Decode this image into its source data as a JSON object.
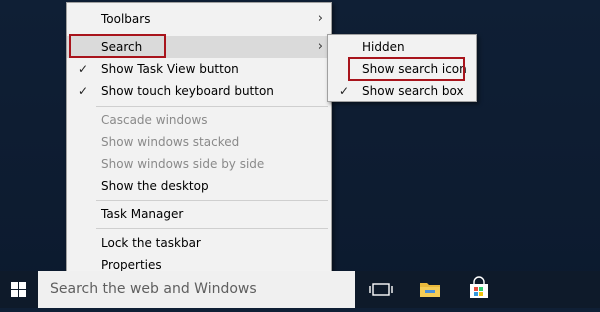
{
  "context_menu": {
    "items": [
      {
        "label": "Toolbars",
        "submenu_arrow": "chevron-right-icon"
      },
      {
        "label": "Search",
        "submenu_arrow": "chevron-right-icon",
        "state": "highlighted"
      },
      {
        "label": "Show Task View button",
        "checked": true
      },
      {
        "label": "Show touch keyboard button",
        "checked": true
      },
      {
        "label": "Cascade windows",
        "disabled": true
      },
      {
        "label": "Show windows stacked",
        "disabled": true
      },
      {
        "label": "Show windows side by side",
        "disabled": true
      },
      {
        "label": "Show the desktop"
      },
      {
        "label": "Task Manager"
      },
      {
        "label": "Lock the taskbar"
      },
      {
        "label": "Properties"
      }
    ],
    "check_glyph": "✓",
    "chevron_glyph": "›"
  },
  "search_submenu": {
    "items": [
      {
        "label": "Hidden"
      },
      {
        "label": "Show search icon",
        "annotated": true
      },
      {
        "label": "Show search box",
        "checked": true
      }
    ]
  },
  "taskbar": {
    "start_icon": "windows-logo-icon",
    "search_placeholder": "Search the web and Windows",
    "task_view_icon": "task-view-icon",
    "file_explorer_icon": "folder-icon",
    "store_icon": "store-bag-icon"
  },
  "colors": {
    "annotation_red": "#a8141c",
    "menu_bg": "#f2f2f2",
    "highlight": "#dadada",
    "taskbar": "#0e1a2a",
    "desktop": "#0f1f35"
  }
}
